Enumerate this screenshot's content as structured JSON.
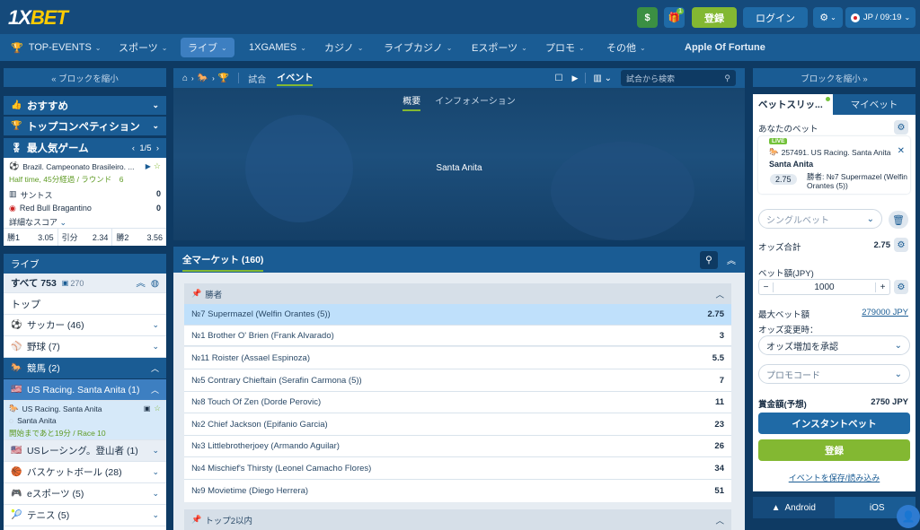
{
  "header": {
    "logo_prefix": "1X",
    "logo_suffix": "BET",
    "dollar_icon": "$",
    "gift_badge": "1",
    "register_label": "登録",
    "login_label": "ログイン",
    "lang_time": "JP / 09:19"
  },
  "nav": {
    "items": [
      {
        "label": "TOP-EVENTS",
        "chev": "⌄"
      },
      {
        "label": "スポーツ",
        "chev": "⌄"
      },
      {
        "label": "ライブ",
        "chev": "⌄"
      },
      {
        "label": "1XGAMES",
        "chev": "⌄"
      },
      {
        "label": "カジノ",
        "chev": "⌄"
      },
      {
        "label": "ライブカジノ",
        "chev": "⌄"
      },
      {
        "label": "Eスポーツ",
        "chev": "⌄"
      },
      {
        "label": "プロモ",
        "chev": "⌄"
      },
      {
        "label": "その他",
        "chev": "⌄"
      }
    ],
    "apple_label": "Apple Of Fortune"
  },
  "left": {
    "collapse_label": "« ブロックを縮小",
    "recommended": "おすすめ",
    "top_competitions": "トップコンペティション",
    "popular": "最人気ゲーム",
    "popular_page": "1/5",
    "match": {
      "league": "Brazil. Campeonato Brasileiro. ...",
      "status": "Half time, 45分経過 / ラウンド　6",
      "team1": "サントス",
      "score1": "0",
      "team2": "Red Bull Bragantino",
      "score2": "0",
      "detail_link": "詳細なスコア",
      "odds": [
        {
          "label": "勝1",
          "value": "3.05"
        },
        {
          "label": "引分",
          "value": "2.34"
        },
        {
          "label": "勝2",
          "value": "3.56"
        }
      ]
    },
    "live_header": "ライブ",
    "all_label": "すべて 753",
    "all_count": "270",
    "top_label": "トップ",
    "sports": [
      {
        "icon": "⚽",
        "label": "サッカー (46)"
      },
      {
        "icon": "⚾",
        "label": "野球 (7)"
      }
    ],
    "horse_racing": "競馬 (2)",
    "santa_anita": "US Racing. Santa Anita (1)",
    "event": {
      "title": "US Racing. Santa Anita",
      "sub": "Santa Anita",
      "status": "開始まであと19分 / Race 10"
    },
    "sports2": [
      {
        "icon": "🇺🇸",
        "label": "USレーシング。登山者 (1)"
      },
      {
        "icon": "🏀",
        "label": "バスケットボール (28)"
      },
      {
        "icon": "🎮",
        "label": "eスポーツ (5)"
      },
      {
        "icon": "🎾",
        "label": "テニス (5)"
      }
    ]
  },
  "center": {
    "tab_match": "試合",
    "tab_event": "イベント",
    "search_placeholder": "試合から検索",
    "subtab_overview": "概要",
    "subtab_info": "インフォメーション",
    "venue": "Santa Anita",
    "all_markets": "全マーケット (160)",
    "group1": "勝者",
    "group2": "トップ2以内",
    "runners": [
      {
        "name": "№7 Supermazel (Welfin Orantes (5))",
        "odd": "2.75"
      },
      {
        "name": "№1 Brother O' Brien (Frank Alvarado)",
        "odd": "3"
      },
      {
        "name": "№11 Roister (Assael Espinoza)",
        "odd": "5.5"
      },
      {
        "name": "№5 Contrary Chieftain (Serafin Carmona (5))",
        "odd": "7"
      },
      {
        "name": "№8 Touch Of Zen (Dorde Perovic)",
        "odd": "11"
      },
      {
        "name": "№2 Chief Jackson (Epifanio Garcia)",
        "odd": "23"
      },
      {
        "name": "№3 Littlebrotherjoey (Armando Aguilar)",
        "odd": "26"
      },
      {
        "name": "№4 Mischief's Thirsty (Leonel Camacho Flores)",
        "odd": "34"
      },
      {
        "name": "№9 Movietime (Diego Herrera)",
        "odd": "51"
      }
    ]
  },
  "right": {
    "collapse_label": "ブロックを縮小 »",
    "tab_slip": "ベットスリッ...",
    "tab_mybets": "マイベット",
    "your_bet": "あなたのベット",
    "live_badge": "LIVE",
    "bet_event": "257491. US Racing. Santa Anita",
    "bet_venue": "Santa Anita",
    "bet_odd": "2.75",
    "bet_pick": "勝者: №7 Supermazel (Welfin Orantes (5))",
    "single_bet": "シングルベット",
    "total_odds_label": "オッズ合計",
    "total_odds": "2.75",
    "stake_label": "ベット額(JPY)",
    "stake_value": "1000",
    "minus": "−",
    "plus": "+",
    "max_bet_label": "最大ベット額",
    "max_bet_value": "279000 JPY",
    "odds_change_label": "オッズ変更時：",
    "odds_change_value": "オッズ増加を承認",
    "promo_placeholder": "プロモコード",
    "payout_label": "賞金額(予想)",
    "payout_value": "2750 JPY",
    "instant_bet": "インスタントベット",
    "register": "登録",
    "save_event": "イベントを保存/読み込み",
    "android": "Android",
    "ios": "iOS"
  },
  "colors": {
    "accent_green": "#83b832",
    "brand_blue": "#1a5c94",
    "dark_blue": "#0e3a63",
    "highlight_row": "#bfe0fb",
    "live_green": "#73c23a"
  }
}
